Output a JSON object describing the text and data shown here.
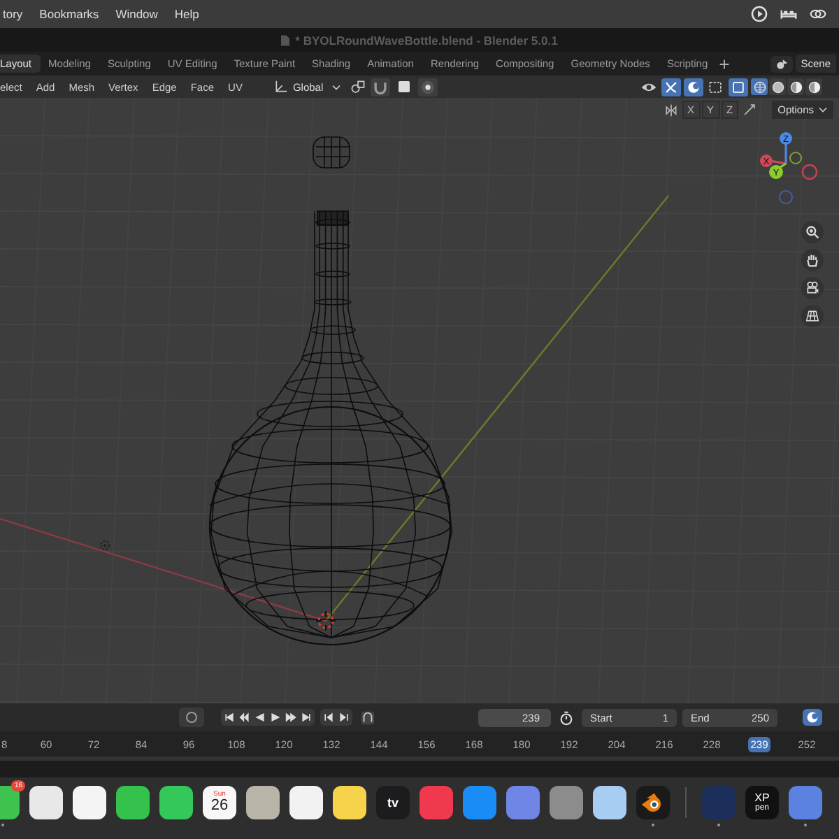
{
  "menubar": {
    "items": [
      "tory",
      "Bookmarks",
      "Window",
      "Help"
    ]
  },
  "window": {
    "title": "* BYOLRoundWaveBottle.blend - Blender 5.0.1"
  },
  "workspaces": [
    {
      "label": "Layout",
      "selected": true
    },
    {
      "label": "Modeling",
      "selected": false
    },
    {
      "label": "Sculpting",
      "selected": false
    },
    {
      "label": "UV Editing",
      "selected": false
    },
    {
      "label": "Texture Paint",
      "selected": false
    },
    {
      "label": "Shading",
      "selected": false
    },
    {
      "label": "Animation",
      "selected": false
    },
    {
      "label": "Rendering",
      "selected": false
    },
    {
      "label": "Compositing",
      "selected": false
    },
    {
      "label": "Geometry Nodes",
      "selected": false
    },
    {
      "label": "Scripting",
      "selected": false
    }
  ],
  "scene": {
    "label": "Scene"
  },
  "header": {
    "menus": [
      "elect",
      "Add",
      "Mesh",
      "Vertex",
      "Edge",
      "Face",
      "UV"
    ],
    "orientation": "Global",
    "shading_modes": [
      {
        "selected": true
      },
      {
        "selected": false
      },
      {
        "selected": false
      },
      {
        "selected": false
      }
    ],
    "mirror_axes": [
      "X",
      "Y",
      "Z"
    ],
    "options": "Options"
  },
  "gizmo": {
    "x": "X",
    "y": "Y",
    "z": "Z"
  },
  "timeline": {
    "current_frame": "239",
    "start_label": "Start",
    "start": "1",
    "end_label": "End",
    "end": "250",
    "ticks": [
      "8",
      "60",
      "72",
      "84",
      "96",
      "108",
      "120",
      "132",
      "144",
      "156",
      "168",
      "180",
      "192",
      "204",
      "216",
      "228",
      "252"
    ],
    "marker": "239"
  },
  "dock": [
    {
      "color": "#3fc34f",
      "badge": "16",
      "running": true
    },
    {
      "color": "#e8e8e8",
      "running": false
    },
    {
      "color": "#f4f4f4",
      "running": false
    },
    {
      "color": "#35c24c",
      "running": false
    },
    {
      "color": "#34c759",
      "running": false
    },
    {
      "color": "#f7f7f7",
      "kind": "calendar",
      "day": "Sun",
      "date": "26",
      "running": false
    },
    {
      "color": "#b8b4a8",
      "running": false
    },
    {
      "color": "#f2f2f2",
      "running": false
    },
    {
      "color": "#f6d34a",
      "running": false
    },
    {
      "color": "#1c1c1e",
      "kind": "label",
      "text": "tv",
      "running": false
    },
    {
      "color": "#f0384e",
      "running": false
    },
    {
      "color": "#1a8cf5",
      "running": false
    },
    {
      "color": "#6f86e6",
      "running": false
    },
    {
      "color": "#8c8c8c",
      "running": false
    },
    {
      "color": "#a7cdf2",
      "running": false
    },
    {
      "color": "#1a1a1a",
      "kind": "blender",
      "running": true
    },
    {
      "color": "#1b2f5a",
      "running": true,
      "separator": true
    },
    {
      "color": "#111111",
      "kind": "xp",
      "text": "XP",
      "text2": "pen",
      "running": false
    },
    {
      "color": "#5b82e0",
      "running": true
    }
  ]
}
